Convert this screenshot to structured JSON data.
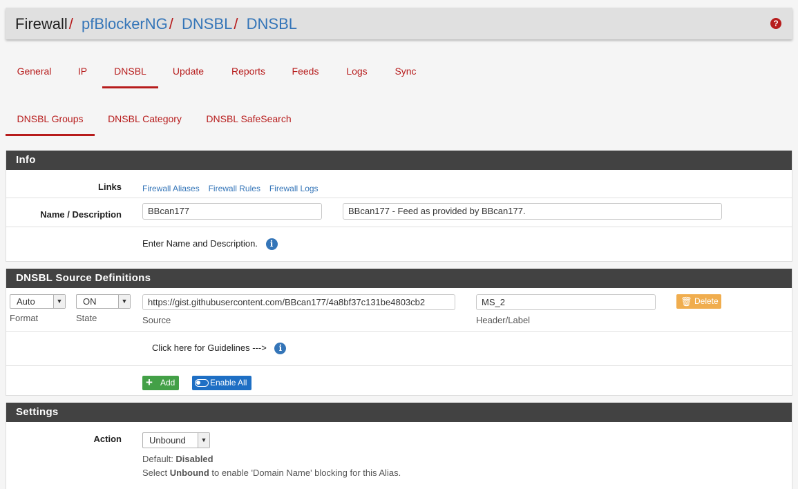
{
  "breadcrumb": {
    "root": "Firewall",
    "items": [
      "pfBlockerNG",
      "DNSBL",
      "DNSBL"
    ],
    "sep": "/"
  },
  "help_icon": "question-circle-icon",
  "tabs_primary": [
    "General",
    "IP",
    "DNSBL",
    "Update",
    "Reports",
    "Feeds",
    "Logs",
    "Sync"
  ],
  "tabs_secondary": [
    "DNSBL Groups",
    "DNSBL Category",
    "DNSBL SafeSearch"
  ],
  "info": {
    "title": "Info",
    "links_label": "Links",
    "links": [
      "Firewall Aliases",
      "Firewall Rules",
      "Firewall Logs"
    ],
    "name_label": "Name / Description",
    "name_value": "BBcan177",
    "description_value": "BBcan177 - Feed as provided by BBcan177.",
    "hint": "Enter Name and Description."
  },
  "sources": {
    "title": "DNSBL Source Definitions",
    "format_value": "Auto",
    "format_label": "Format",
    "state_value": "ON",
    "state_label": "State",
    "source_value": "https://gist.githubusercontent.com/BBcan177/4a8bf37c131be4803cb2",
    "source_label": "Source",
    "header_value": "MS_2",
    "header_label": "Header/Label",
    "delete_label": "Delete",
    "guidelines": "Click here for Guidelines --->",
    "add_label": "Add",
    "enable_all_label": "Enable All"
  },
  "settings": {
    "title": "Settings",
    "action_label": "Action",
    "action_value": "Unbound",
    "default_prefix": "Default: ",
    "default_value": "Disabled",
    "select_prefix": "Select ",
    "select_bold": "Unbound",
    "select_suffix": " to enable 'Domain Name' blocking for this Alias."
  },
  "colors": {
    "accent": "#b71c1c",
    "link": "#3475b8",
    "panel_head": "#424242",
    "add_btn": "#43a047",
    "enable_btn": "#1e6fc4",
    "delete_btn": "#f0ad4e"
  }
}
